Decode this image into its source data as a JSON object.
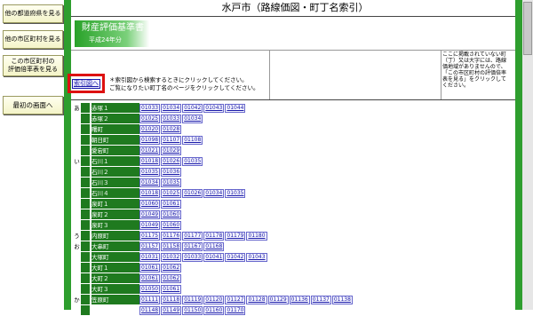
{
  "sidebar": {
    "buttons": [
      {
        "label": "他の都道府県を見る"
      },
      {
        "label": "他の市区町村を見る"
      },
      {
        "label": "この市区町村の\n評価倍率表を見る"
      },
      {
        "label": "最初の画面へ"
      }
    ]
  },
  "header": {
    "title": "水戸市（路線価図・町丁名索引）",
    "badge_title": "財産評価基準書",
    "badge_sub": "平成24年分"
  },
  "notice": "ここに掲載されていない町（丁）又は大字には、路線価地域がありませんので、「この市区町村の評価倍率表を見る」をクリックしてください。",
  "index_button": "索引図へ",
  "instructions": [
    "＊索引図から検索するときにクリックしてください。",
    "ご覧になりたい町丁名のページをクリックしてください。"
  ],
  "rows": [
    {
      "kana": "あ",
      "name": "赤塚１",
      "pages": [
        "01033",
        "01034",
        "01042",
        "01043",
        "01044"
      ]
    },
    {
      "kana": "",
      "name": "赤塚２",
      "pages": [
        "01025",
        "01033",
        "01034"
      ]
    },
    {
      "kana": "",
      "name": "曙町",
      "pages": [
        "01020",
        "01028"
      ]
    },
    {
      "kana": "",
      "name": "朝日町",
      "pages": [
        "01098",
        "01107",
        "01108"
      ]
    },
    {
      "kana": "",
      "name": "愛宕町",
      "pages": [
        "01021",
        "01029"
      ]
    },
    {
      "kana": "い",
      "name": "石川１",
      "pages": [
        "01018",
        "01026",
        "01035"
      ]
    },
    {
      "kana": "",
      "name": "石川２",
      "pages": [
        "01035",
        "01036"
      ]
    },
    {
      "kana": "",
      "name": "石川３",
      "pages": [
        "01034",
        "01035"
      ]
    },
    {
      "kana": "",
      "name": "石川４",
      "pages": [
        "01018",
        "01025",
        "01026",
        "01034",
        "01035"
      ]
    },
    {
      "kana": "",
      "name": "泉町１",
      "pages": [
        "01060",
        "01061"
      ]
    },
    {
      "kana": "",
      "name": "泉町２",
      "pages": [
        "01049",
        "01060"
      ]
    },
    {
      "kana": "",
      "name": "泉町３",
      "pages": [
        "01049",
        "01060"
      ]
    },
    {
      "kana": "う",
      "name": "内原町",
      "pages": [
        "01175",
        "01176",
        "01177",
        "01178",
        "01179",
        "01180"
      ]
    },
    {
      "kana": "お",
      "name": "大串町",
      "pages": [
        "01157",
        "01158",
        "01167",
        "01168"
      ]
    },
    {
      "kana": "",
      "name": "大塚町",
      "pages": [
        "01031",
        "01032",
        "01033",
        "01041",
        "01042",
        "01043"
      ]
    },
    {
      "kana": "",
      "name": "大町１",
      "pages": [
        "01061",
        "01062"
      ]
    },
    {
      "kana": "",
      "name": "大町２",
      "pages": [
        "01061",
        "01062"
      ]
    },
    {
      "kana": "",
      "name": "大町３",
      "pages": [
        "01050",
        "01061"
      ]
    },
    {
      "kana": "か",
      "name": "笠原町",
      "pages": [
        "01111",
        "01118",
        "01119",
        "01120",
        "01127",
        "01128",
        "01129",
        "01136",
        "01137",
        "01138"
      ]
    },
    {
      "kana": "",
      "name": "",
      "pages": [
        "01148",
        "01149",
        "01150",
        "01160",
        "01170"
      ]
    }
  ]
}
